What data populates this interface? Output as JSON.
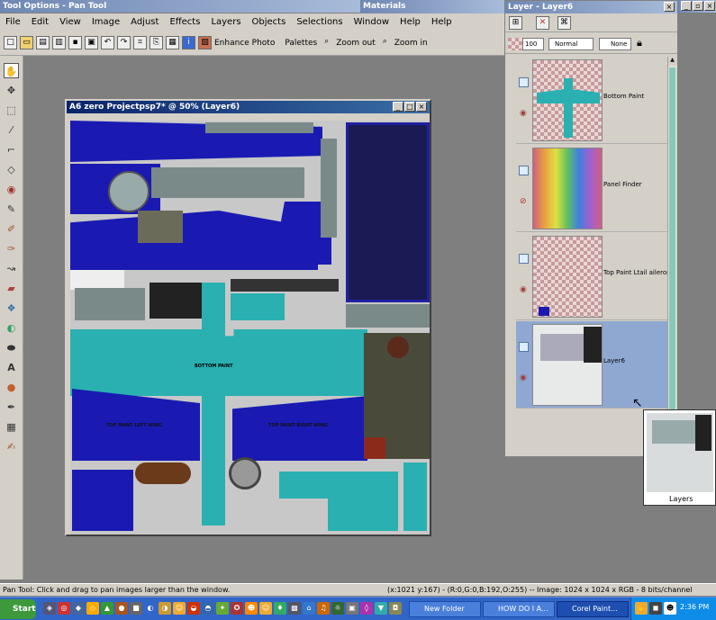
{
  "title_bar": {
    "title": "Tool Options - Pan Tool"
  },
  "materials_bar": {
    "title": "Materials"
  },
  "menu": {
    "items": [
      "File",
      "Edit",
      "View",
      "Image",
      "Adjust",
      "Effects",
      "Layers",
      "Objects",
      "Selections",
      "Window",
      "Help",
      "Help"
    ]
  },
  "toolbar": {
    "enhance_photo": "Enhance Photo",
    "palettes": "Palettes",
    "zoom_out": "Zoom out",
    "zoom_in": "Zoom in"
  },
  "document": {
    "title": "A6 zero Projectpsp7* @  50% (Layer6)",
    "texture_labels": {
      "bottom_paint": "BOTTOM PAINT",
      "top_paint_1": "TOP PAINT LEFT WING",
      "top_paint_2": "TOP PAINT RIGHT WING"
    }
  },
  "layer_palette": {
    "title": "Layer - Layer6",
    "opacity": "100",
    "blend_mode": "Normal",
    "lock": "None",
    "layers": [
      {
        "name": "Bottom Paint"
      },
      {
        "name": "Panel Finder"
      },
      {
        "name": "Top Paint Ltail aileron"
      },
      {
        "name": "Layer6",
        "selected": true
      }
    ]
  },
  "drag_tooltip": {
    "label": "Layers"
  },
  "status": {
    "left": "Pan Tool: Click and drag to pan images larger than the window.",
    "right": "(x:1021 y:167) - (R:0,G:0,B:192,O:255) -- Image:  1024 x 1024 x RGB - 8 bits/channel"
  },
  "taskbar": {
    "start": "Start",
    "tasks": [
      "New Folder",
      "HOW DO I A...",
      "Corel Paint..."
    ],
    "clock": "2:36 PM"
  },
  "colors": {
    "accent": "#6f87b3",
    "selected_layer": "#8fa8d2",
    "taskbar": "#3165c8"
  }
}
